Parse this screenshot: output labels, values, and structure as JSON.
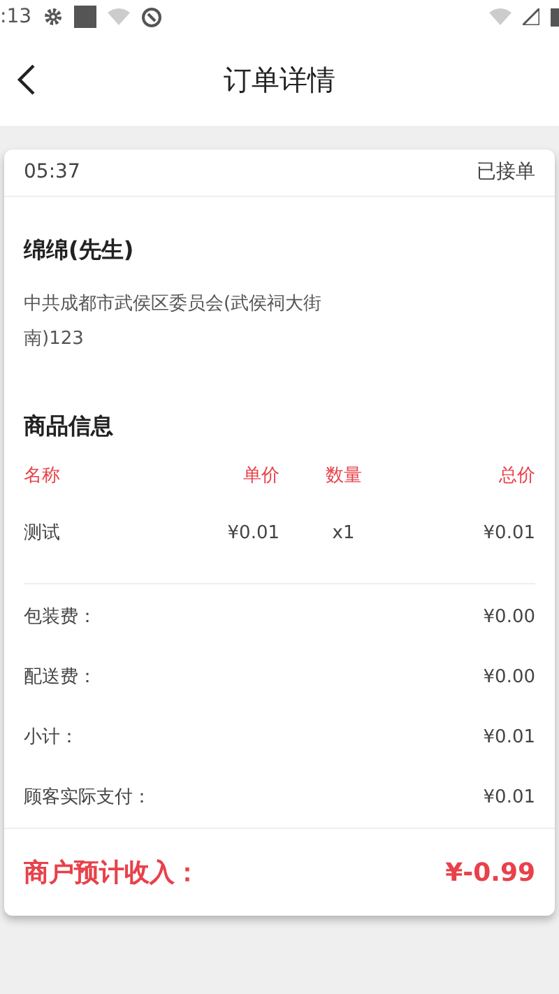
{
  "status_bar": {
    "time": ":13"
  },
  "header": {
    "title": "订单详情"
  },
  "order": {
    "time": "05:37",
    "status": "已接单"
  },
  "customer": {
    "name": "绵绵(先生)",
    "address": "中共成都市武侯区委员会(武侯祠大街南)123"
  },
  "goods": {
    "title": "商品信息",
    "columns": [
      "名称",
      "单价",
      "数量",
      "总价"
    ],
    "rows": [
      [
        "测试",
        "¥0.01",
        "x1",
        "¥0.01"
      ]
    ]
  },
  "fees": [
    {
      "label": "包装费：",
      "value": "¥0.00"
    },
    {
      "label": "配送费：",
      "value": "¥0.00"
    },
    {
      "label": "小计：",
      "value": "¥0.01"
    },
    {
      "label": "顾客实际支付：",
      "value": "¥0.01"
    }
  ],
  "income": {
    "label": "商户预计收入：",
    "value": "¥-0.99"
  }
}
